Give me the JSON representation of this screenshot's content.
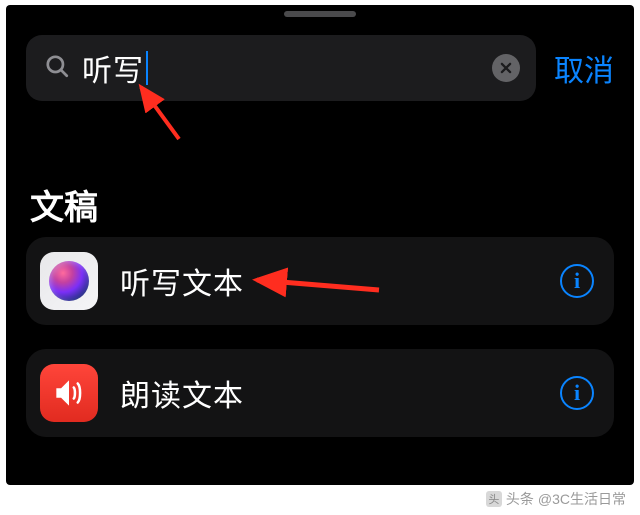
{
  "search": {
    "query": "听写",
    "cancel_label": "取消"
  },
  "section": {
    "title": "文稿"
  },
  "results": [
    {
      "label": "听写文本",
      "icon": "siri"
    },
    {
      "label": "朗读文本",
      "icon": "speak"
    }
  ],
  "watermark": {
    "source": "头条",
    "account": "@3C生活日常"
  },
  "colors": {
    "accent": "#0a84ff",
    "speak_icon_bg": "#ff453a"
  }
}
